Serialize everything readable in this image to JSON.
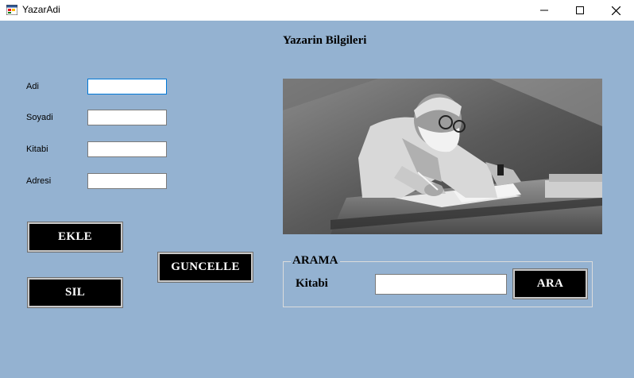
{
  "window": {
    "title": "YazarAdi",
    "controls": {
      "minimize": "minimize-icon",
      "maximize": "maximize-icon",
      "close": "close-icon"
    }
  },
  "form": {
    "title": "Yazarin Bilgileri",
    "fields": [
      {
        "label": "Adi",
        "value": "",
        "focused": true
      },
      {
        "label": "Soyadi",
        "value": ""
      },
      {
        "label": "Kitabi",
        "value": ""
      },
      {
        "label": "Adresi",
        "value": ""
      }
    ],
    "buttons": {
      "add": "EKLE",
      "delete": "SIL",
      "update": "GUNCELLE"
    },
    "photo": {
      "icon": "author-photo"
    }
  },
  "search": {
    "legend": "ARAMA",
    "label": "Kitabi",
    "value": "",
    "button": "ARA"
  },
  "colors": {
    "background": "#94b2d1",
    "button_bg": "#000000",
    "button_text": "#ffffff",
    "focus_border": "#0078d7"
  }
}
